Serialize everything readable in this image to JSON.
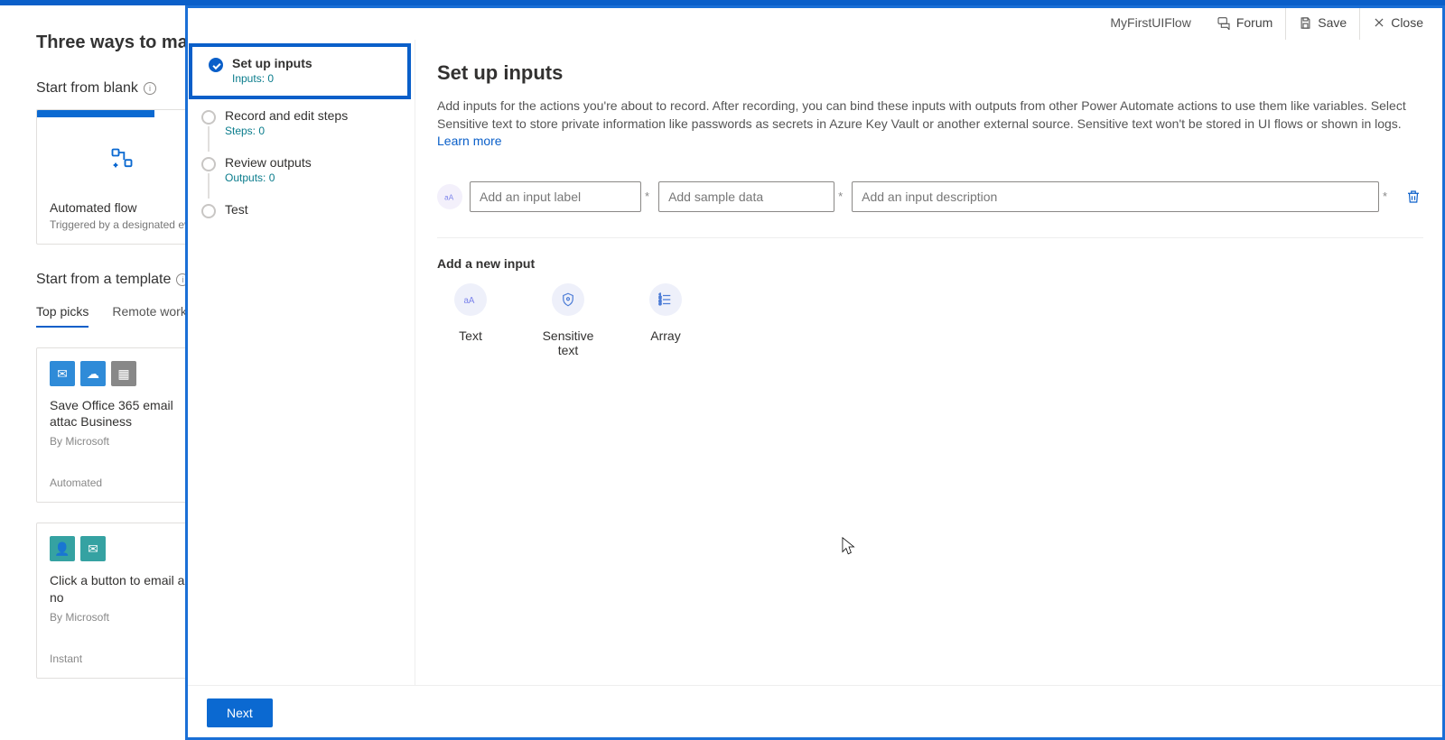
{
  "background": {
    "heading": "Three ways to make a f",
    "start_blank": "Start from blank",
    "automated_card": {
      "title": "Automated flow",
      "subtitle": "Triggered by a designated ev"
    },
    "start_template": "Start from a template",
    "tabs": {
      "top_picks": "Top picks",
      "remote_work": "Remote work"
    },
    "template1": {
      "title": "Save Office 365 email attac Business",
      "by": "By Microsoft",
      "type": "Automated"
    },
    "template2": {
      "title": "Click a button to email a no",
      "by": "By Microsoft",
      "type": "Instant"
    }
  },
  "header": {
    "flow_name": "MyFirstUIFlow",
    "forum": "Forum",
    "save": "Save",
    "close": "Close"
  },
  "steps": [
    {
      "label": "Set up inputs",
      "sub": "Inputs: 0"
    },
    {
      "label": "Record and edit steps",
      "sub": "Steps: 0"
    },
    {
      "label": "Review outputs",
      "sub": "Outputs: 0"
    },
    {
      "label": "Test",
      "sub": ""
    }
  ],
  "main": {
    "title": "Set up inputs",
    "description": "Add inputs for the actions you're about to record. After recording, you can bind these inputs with outputs from other Power Automate actions to use them like variables. Select Sensitive text to store private information like passwords as secrets in Azure Key Vault or another external source. Sensitive text won't be stored in UI flows or shown in logs. ",
    "learn_more": "Learn more",
    "input_row": {
      "label_placeholder": "Add an input label",
      "sample_placeholder": "Add sample data",
      "desc_placeholder": "Add an input description"
    },
    "add_new": "Add a new input",
    "types": {
      "text": "Text",
      "sensitive": "Sensitive text",
      "array": "Array"
    },
    "next": "Next"
  }
}
